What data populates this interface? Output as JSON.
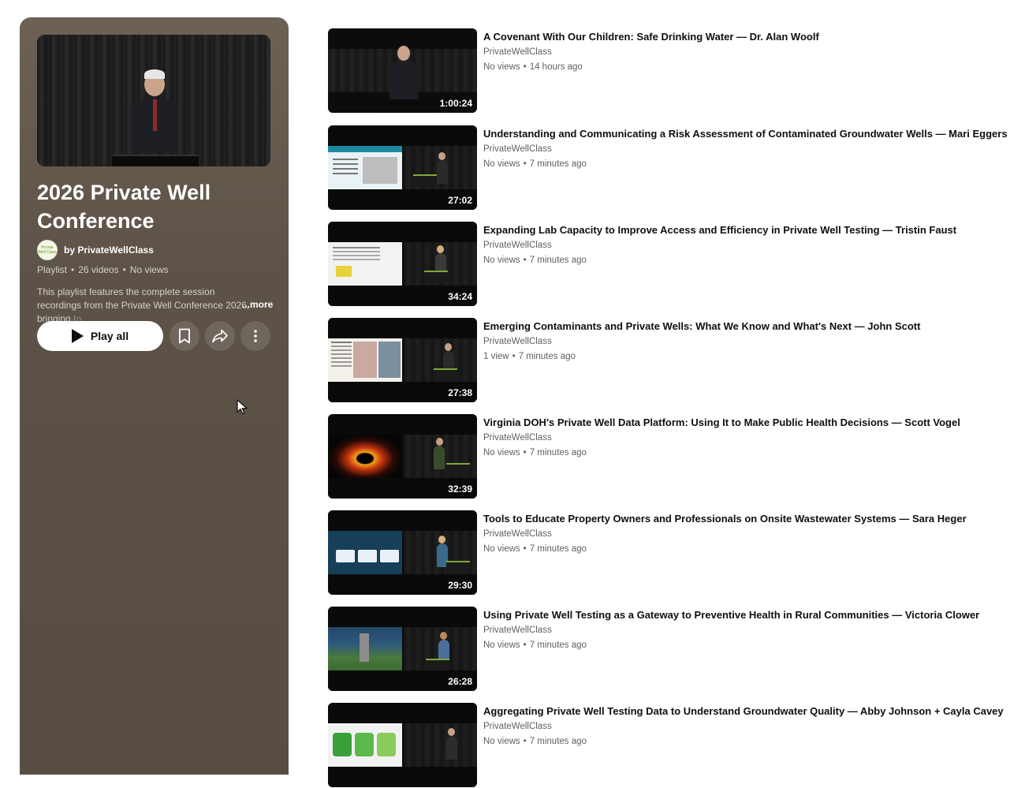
{
  "playlist": {
    "title": "2026 Private Well Conference",
    "owner_avatar_text": "Private Well Class",
    "owner_label": "by PrivateWellClass",
    "type_label": "Playlist",
    "video_count": "26 videos",
    "views": "No views",
    "description_visible": "This playlist features the complete session recordings from the Private Well Conference 2026, bringing",
    "description_faded": "to",
    "more_label": "...more",
    "play_all_label": "Play all",
    "icons": [
      "play-icon",
      "bookmark-icon",
      "share-icon",
      "more-vertical-icon"
    ],
    "panel_color": "#5d5247"
  },
  "videos": [
    {
      "title": "A Covenant With Our Children: Safe Drinking Water — Dr. Alan Woolf",
      "channel": "PrivateWellClass",
      "views": "No views",
      "age": "14 hours ago",
      "duration": "1:00:24"
    },
    {
      "title": "Understanding and Communicating a Risk Assessment of Contaminated Groundwater Wells — Mari Eggers",
      "channel": "PrivateWellClass",
      "views": "No views",
      "age": "7 minutes ago",
      "duration": "27:02"
    },
    {
      "title": "Expanding Lab Capacity to Improve Access and Efficiency in Private Well Testing — Tristin Faust",
      "channel": "PrivateWellClass",
      "views": "No views",
      "age": "7 minutes ago",
      "duration": "34:24"
    },
    {
      "title": "Emerging Contaminants and Private Wells: What We Know and What's Next — John Scott",
      "channel": "PrivateWellClass",
      "views": "1 view",
      "age": "7 minutes ago",
      "duration": "27:38"
    },
    {
      "title": "Virginia DOH's Private Well Data Platform: Using It to Make Public Health Decisions — Scott Vogel",
      "channel": "PrivateWellClass",
      "views": "No views",
      "age": "7 minutes ago",
      "duration": "32:39"
    },
    {
      "title": "Tools to Educate Property Owners and Professionals on Onsite Wastewater Systems — Sara Heger",
      "channel": "PrivateWellClass",
      "views": "No views",
      "age": "7 minutes ago",
      "duration": "29:30"
    },
    {
      "title": "Using Private Well Testing as a Gateway to Preventive Health in Rural Communities — Victoria Clower",
      "channel": "PrivateWellClass",
      "views": "No views",
      "age": "7 minutes ago",
      "duration": "26:28"
    },
    {
      "title": "Aggregating Private Well Testing Data to Understand Groundwater Quality — Abby Johnson + Cayla Cavey",
      "channel": "PrivateWellClass",
      "views": "No views",
      "age": "7 minutes ago",
      "duration": ""
    }
  ]
}
